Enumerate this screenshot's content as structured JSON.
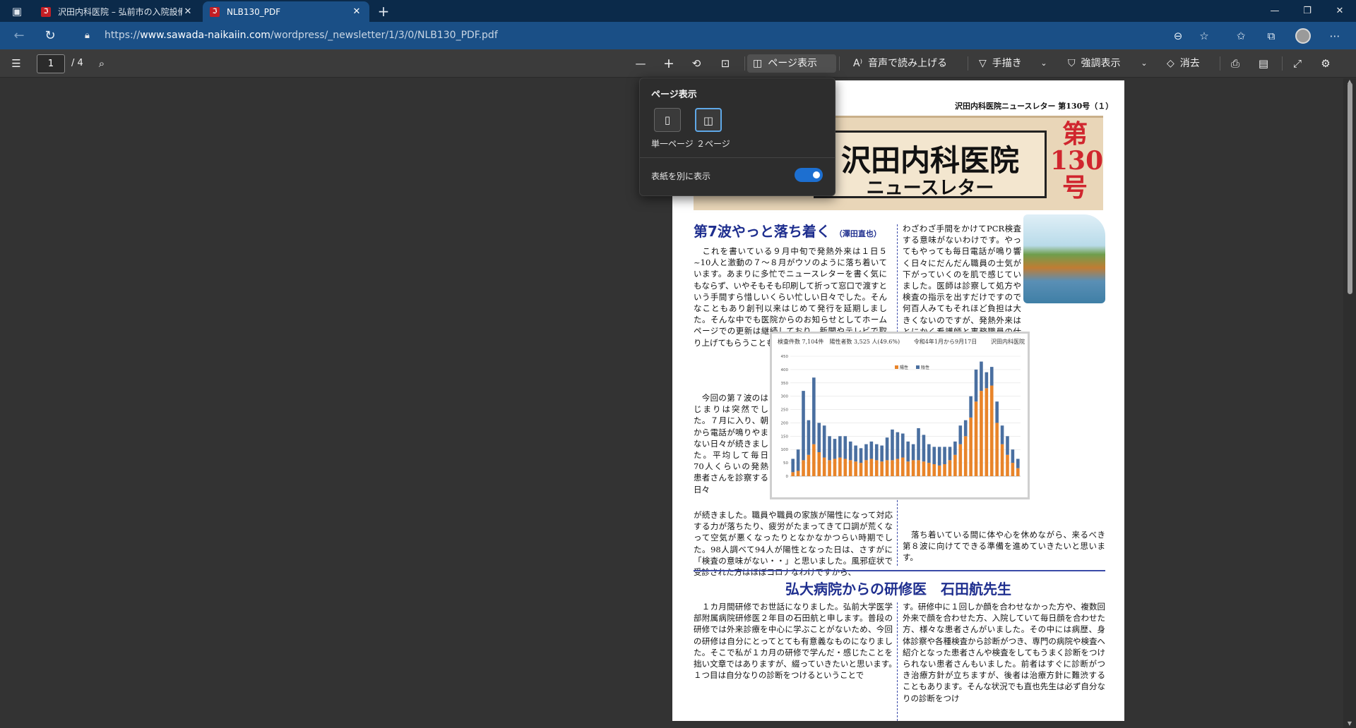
{
  "browser": {
    "tabs": [
      {
        "title": "沢田内科医院 – 弘前市の入院設備",
        "favicon": "pdf-favicon",
        "active": false
      },
      {
        "title": "NLB130_PDF",
        "favicon": "pdf-favicon",
        "active": true
      }
    ],
    "new_tab_icon": "+",
    "url_prefix": "https://",
    "url_host": "www.sawada-naikaiin.com",
    "url_path": "/wordpress/_newsletter/1/3/0/NLB130_PDF.pdf"
  },
  "pdf_toolbar": {
    "page_current": "1",
    "page_total": "/ 4",
    "page_view_label": "ページ表示",
    "read_aloud_label": "音声で読み上げる",
    "draw_label": "手描き",
    "highlight_label": "強調表示",
    "erase_label": "消去"
  },
  "popup": {
    "title": "ページ表示",
    "single_page_label": "単一ページ",
    "two_page_label": "２ページ",
    "cover_toggle_label": "表紙を別に表示",
    "cover_toggle_on": true
  },
  "document": {
    "issue_line": "沢田内科医院ニュースレター 第130号（１）",
    "banner_name": "沢田内科医院",
    "banner_sub": "ニュースレター",
    "banner_issue": "第130号",
    "headline": "第7波やっと落ち着く",
    "headline_author": "（澤田直也）",
    "col_left_top": "　これを書いている９月中旬で発熱外来は１日５~10人と激動の７～８月がウソのように落ち着いています。あまりに多忙でニュースレターを書く気にもならず、いやそもそも印刷して折って窓口で渡すという手間すら惜しいくらい忙しい日々でした。そんなこともあり創刊以来はじめて発行を延期しました。そんな中でも医院からのお知らせとしてホームページでの更新は継続しており、新聞やテレビで取り上げてもらうことも増えました。",
    "col_left_mid": "　今回の第７波のはじまりは突然でした。７月に入り、朝から電話が鳴りやまない日々が続きました。平均して毎日70人くらいの発熱患者さんを診察する日々",
    "col_left_bottom": "が続きました。職員や職員の家族が陽性になって対応する力が落ちたり、疲労がたまってきて口調が荒くなって空気が悪くなったりとなかなかつらい時期でした。98人調べて94人が陽性となった日は、さすがに「検査の意味がない・・」と思いました。風邪症状で受診された方はほぼコロナなわけですから、",
    "col_right_top": "わざわざ手間をかけてPCR検査する意味がないわけです。やってもやっても毎日電話が鳴り響く日々にだんだん職員の士気が下がっていくのを肌で感じていました。医師は診察して処方や検査の指示を出すだけですので何百人みてもそれほど負担は大きくないのですが、発熱外来はとにかく看護師と事務職員の仕事が多く、残業も膨大な時間になりました。追い打ちをかけるように解熱鎮痛剤が手に入らなくなったりと、一時は「医療崩壊」と口にせざるを得ないような状況に陥りました。病院にかかりたいのにかかれない、かかっても検査ができない、薬の処方ができないとなれば医療機関としての役割を果たせなくなってしまっていたわけです。",
    "col_right_end": "　落ち着いている間に体や心を休めながら、来るべき第８波に向けてできる準備を進めていきたいと思います。",
    "section2_title": "弘大病院からの研修医　石田航先生",
    "s2_left": "　１カ月間研修でお世話になりました。弘前大学医学部附属病院研修医２年目の石田航と申します。普段の研修では外来診療を中心に学ぶことがないため、今回の研修は自分にとってとても有意義なものになりました。そこで私が１カ月の研修で学んだ・感じたことを拙い文章ではありますが、綴っていきたいと思います。　　　　１つ目は自分なりの診断をつけるということで",
    "s2_right": "す。研修中に１回しか顔を合わせなかった方や、複数回外来で顔を合わせた方、入院していて毎日顔を合わせた方、様々な患者さんがいました。その中には病歴、身体診察や各種検査から診断がつき、専門の病院や検査へ紹介となった患者さんや検査をしてもうまく診断をつけられない患者さんもいました。前者はすぐに診断がつき治療方針が立ちますが、後者は治療方針に難渋することもあります。そんな状況でも直也先生は必ず自分なりの診断をつけ"
  },
  "chart_data": {
    "type": "bar",
    "stacked": true,
    "header_left": "検査件数 7,104件　陽性者数 3,525 人(49.6%)",
    "header_mid": "令和4年1月から9月17日",
    "header_right": "沢田内科医院",
    "legend": [
      "陽性",
      "陰性"
    ],
    "colors": {
      "陽性": "#e8842a",
      "陰性": "#4a6fa0"
    },
    "ylim": [
      0,
      450
    ],
    "yticks": [
      0,
      50,
      100,
      150,
      200,
      250,
      300,
      350,
      400,
      450
    ],
    "series": [
      {
        "name": "陽性",
        "values": [
          15,
          20,
          60,
          80,
          120,
          90,
          70,
          60,
          65,
          70,
          65,
          60,
          55,
          50,
          60,
          65,
          60,
          55,
          60,
          60,
          65,
          70,
          55,
          60,
          60,
          55,
          50,
          45,
          40,
          45,
          60,
          80,
          120,
          150,
          220,
          280,
          320,
          330,
          340,
          200,
          120,
          80,
          50,
          30
        ]
      },
      {
        "name": "陰性",
        "values": [
          50,
          80,
          260,
          130,
          250,
          110,
          120,
          90,
          75,
          80,
          85,
          70,
          60,
          55,
          60,
          65,
          60,
          60,
          85,
          115,
          100,
          90,
          75,
          60,
          120,
          100,
          70,
          65,
          70,
          65,
          50,
          50,
          70,
          60,
          80,
          120,
          110,
          60,
          70,
          80,
          70,
          70,
          50,
          35
        ]
      }
    ]
  }
}
